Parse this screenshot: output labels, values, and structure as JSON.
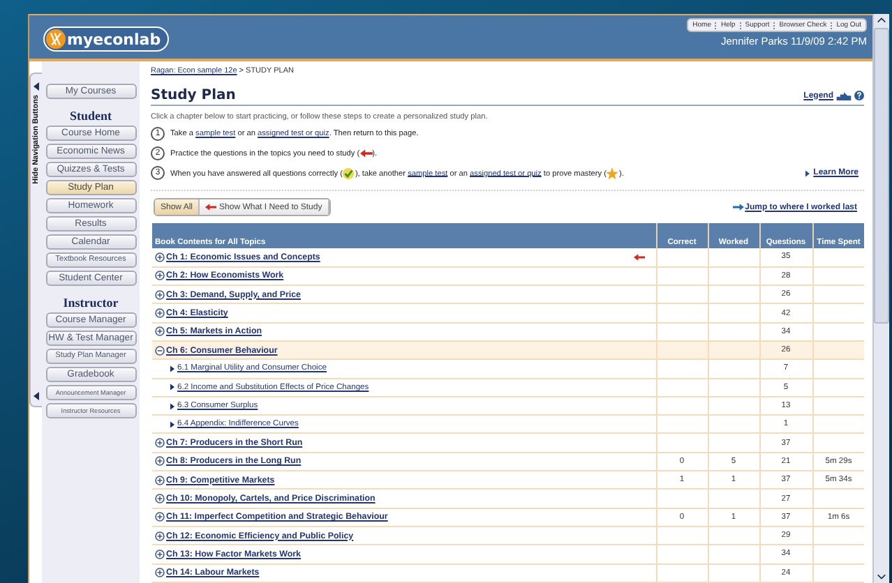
{
  "header": {
    "logo": "myeconlab",
    "top_links": [
      "Home",
      "Help",
      "Support",
      "Browser Check",
      "Log Out"
    ],
    "user_line": "Jennifer Parks 11/9/09 2:42 PM"
  },
  "nav_toggle": {
    "label": "Hide Navigation Buttons"
  },
  "sidebar": {
    "groups": [
      {
        "items": [
          {
            "label": "My Courses",
            "selected": false
          }
        ]
      },
      {
        "heading": "Student",
        "items": [
          {
            "label": "Course Home",
            "selected": false
          },
          {
            "label": "Economic News",
            "selected": false
          },
          {
            "label": "Quizzes & Tests",
            "selected": false
          },
          {
            "label": "Study Plan",
            "selected": true
          },
          {
            "label": "Homework",
            "selected": false
          },
          {
            "label": "Results",
            "selected": false
          },
          {
            "label": "Calendar",
            "selected": false
          },
          {
            "label": "Textbook Resources",
            "selected": false
          },
          {
            "label": "Student Center",
            "selected": false
          }
        ]
      },
      {
        "heading": "Instructor",
        "items": [
          {
            "label": "Course Manager",
            "selected": false
          },
          {
            "label": "HW & Test Manager",
            "selected": false
          },
          {
            "label": "Study Plan Manager",
            "selected": false
          },
          {
            "label": "Gradebook",
            "selected": false
          },
          {
            "label": "Announcement Manager",
            "selected": false
          },
          {
            "label": "Instructor Resources",
            "selected": false
          }
        ]
      }
    ]
  },
  "breadcrumb": {
    "link": "Ragan: Econ sample 12e",
    "rest": " > STUDY PLAN"
  },
  "title": "Study Plan",
  "legend_link": "Legend",
  "intro": "Click a chapter below to start practicing, or follow these steps to create a personalized study plan.",
  "steps": [
    {
      "number": "1",
      "parts": [
        {
          "kind": "text",
          "text": "Take a "
        },
        {
          "kind": "link",
          "text": "sample test"
        },
        {
          "kind": "text",
          "text": " or an "
        },
        {
          "kind": "link",
          "text": "assigned test or quiz"
        },
        {
          "kind": "text",
          "text": ". Then return to this page."
        }
      ]
    },
    {
      "number": "2",
      "parts": [
        {
          "kind": "text",
          "text": "Practice the questions in the topics you need to study ("
        },
        {
          "kind": "arrow"
        },
        {
          "kind": "text",
          "text": ")."
        }
      ]
    },
    {
      "number": "3",
      "parts": [
        {
          "kind": "text",
          "text": "When you have answered all questions correctly ("
        },
        {
          "kind": "check"
        },
        {
          "kind": "text",
          "text": "), take another "
        },
        {
          "kind": "link",
          "text": "sample test"
        },
        {
          "kind": "text",
          "text": " or an "
        },
        {
          "kind": "link",
          "text": "assigned test or quiz"
        },
        {
          "kind": "text",
          "text": " to prove mastery ("
        },
        {
          "kind": "star"
        },
        {
          "kind": "text",
          "text": ")."
        }
      ]
    }
  ],
  "learn_more": "Learn More",
  "filter_buttons": [
    {
      "label": "Show All",
      "selected": true,
      "kind": "plain"
    },
    {
      "label": "Show What I Need to Study",
      "selected": false,
      "kind": "arrow"
    }
  ],
  "jump_link": "Jump to where I worked last",
  "table": {
    "columns": [
      "Book Contents for All Topics",
      "Correct",
      "Worked",
      "Questions",
      "Time Spent"
    ],
    "rows": [
      {
        "topic": "Ch 1: Economic Issues and Concepts",
        "expanded": false,
        "needs_study": true,
        "correct": "",
        "worked": "",
        "questions": "35",
        "time": ""
      },
      {
        "topic": "Ch 2: How Economists Work",
        "expanded": false,
        "needs_study": false,
        "questions": "28"
      },
      {
        "topic": "Ch 3: Demand, Supply, and Price",
        "expanded": false,
        "needs_study": false,
        "questions": "26"
      },
      {
        "topic": "Ch 4: Elasticity",
        "expanded": false,
        "needs_study": false,
        "questions": "42"
      },
      {
        "topic": "Ch 5: Markets in Action",
        "expanded": false,
        "needs_study": false,
        "questions": "34"
      },
      {
        "topic": "Ch 6: Consumer Behaviour",
        "expanded": true,
        "needs_study": false,
        "questions": "26",
        "children": [
          {
            "topic": "6.1 Marginal Utility and Consumer Choice",
            "questions": "7"
          },
          {
            "topic": "6.2 Income and Substitution Effects of Price Changes",
            "questions": "5"
          },
          {
            "topic": "6.3 Consumer Surplus",
            "questions": "13"
          },
          {
            "topic": "6.4 Appendix: Indifference Curves",
            "questions": "1"
          }
        ]
      },
      {
        "topic": "Ch 7: Producers in the Short Run",
        "expanded": false,
        "needs_study": false,
        "questions": "37"
      },
      {
        "topic": "Ch 8: Producers in the Long Run",
        "expanded": false,
        "needs_study": false,
        "correct": "0",
        "worked": "5",
        "questions": "21",
        "time": "5m 29s"
      },
      {
        "topic": "Ch 9: Competitive Markets",
        "expanded": false,
        "needs_study": false,
        "correct": "1",
        "worked": "1",
        "questions": "37",
        "time": "5m 34s"
      },
      {
        "topic": "Ch 10: Monopoly, Cartels, and Price Discrimination",
        "expanded": false,
        "needs_study": false,
        "questions": "27"
      },
      {
        "topic": "Ch 11: Imperfect Competition and Strategic Behaviour",
        "expanded": false,
        "needs_study": false,
        "correct": "0",
        "worked": "1",
        "questions": "37",
        "time": "1m 6s"
      },
      {
        "topic": "Ch 12: Economic Efficiency and Public Policy",
        "expanded": false,
        "needs_study": false,
        "questions": "29"
      },
      {
        "topic": "Ch 13: How Factor Markets Work",
        "expanded": false,
        "needs_study": false,
        "questions": "34"
      },
      {
        "topic": "Ch 14: Labour Markets",
        "expanded": false,
        "needs_study": false,
        "questions": "24"
      }
    ]
  }
}
